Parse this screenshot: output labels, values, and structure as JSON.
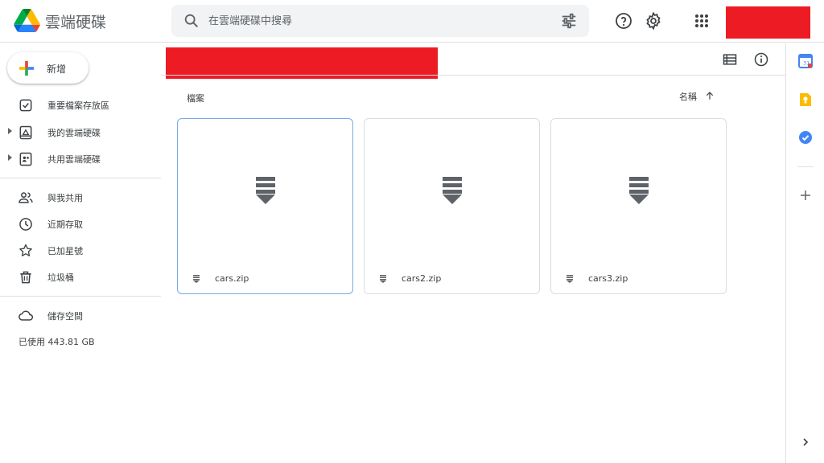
{
  "app": {
    "title": "雲端硬碟"
  },
  "search": {
    "placeholder": "在雲端硬碟中搜尋"
  },
  "sidebar": {
    "new_label": "新增",
    "items": [
      {
        "label": "重要檔案存放區",
        "icon": "priority-check-icon"
      },
      {
        "label": "我的雲端硬碟",
        "icon": "my-drive-icon"
      },
      {
        "label": "共用雲端硬碟",
        "icon": "shared-drives-icon"
      },
      {
        "label": "與我共用",
        "icon": "people-icon"
      },
      {
        "label": "近期存取",
        "icon": "clock-icon"
      },
      {
        "label": "已加星號",
        "icon": "star-icon"
      },
      {
        "label": "垃圾桶",
        "icon": "trash-icon"
      },
      {
        "label": "儲存空間",
        "icon": "cloud-icon"
      }
    ],
    "storage_used": "已使用 443.81 GB"
  },
  "main": {
    "section_label": "檔案",
    "sort_label": "名稱",
    "files": [
      {
        "name": "cars.zip",
        "selected": true
      },
      {
        "name": "cars2.zip",
        "selected": false
      },
      {
        "name": "cars3.zip",
        "selected": false
      }
    ]
  },
  "colors": {
    "redaction": "#ed1c24",
    "selected_border": "#7aa8e6",
    "icon_gray": "#5f6368"
  }
}
